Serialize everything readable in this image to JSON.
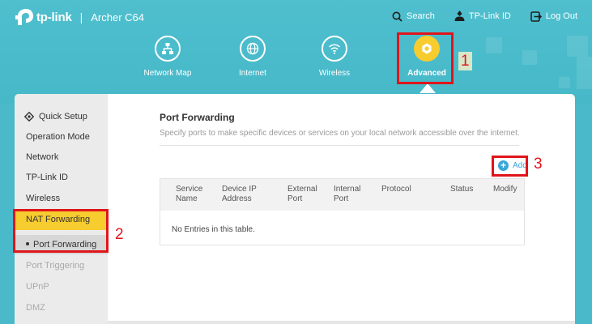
{
  "header": {
    "brand": "tp-link",
    "separator": "|",
    "model": "Archer C64",
    "links": {
      "search": "Search",
      "tplink_id": "TP-Link ID",
      "logout": "Log Out"
    }
  },
  "nav": {
    "items": [
      {
        "label": "Network Map",
        "icon": "network-map-icon"
      },
      {
        "label": "Internet",
        "icon": "globe-icon"
      },
      {
        "label": "Wireless",
        "icon": "wifi-icon"
      },
      {
        "label": "Advanced",
        "icon": "gear-icon",
        "active": true
      }
    ]
  },
  "sidebar": {
    "items": [
      {
        "label": "Quick Setup",
        "icon": "quick-setup-icon"
      },
      {
        "label": "Operation Mode"
      },
      {
        "label": "Network"
      },
      {
        "label": "TP-Link ID"
      },
      {
        "label": "Wireless"
      },
      {
        "label": "NAT Forwarding",
        "active": true
      },
      {
        "label": "Port Forwarding",
        "selected": true
      },
      {
        "label": "Port Triggering"
      },
      {
        "label": "UPnP"
      },
      {
        "label": "DMZ"
      }
    ]
  },
  "main": {
    "title": "Port Forwarding",
    "description": "Specify ports to make specific devices or services on your local network accessible over the internet.",
    "add_label": "Add",
    "table": {
      "columns": [
        [
          "Service",
          "Name"
        ],
        [
          "Device IP",
          "Address"
        ],
        [
          "External",
          "Port"
        ],
        [
          "Internal",
          "Port"
        ],
        [
          "Protocol",
          ""
        ],
        [
          "Status",
          ""
        ],
        [
          "Modify",
          ""
        ]
      ],
      "empty_text": "No Entries in this table."
    }
  },
  "annotations": {
    "labels": [
      "1",
      "2",
      "3"
    ],
    "color": "#e0151b"
  },
  "colors": {
    "header_bg": "#4fbfce",
    "accent_yellow": "#f7cc2f",
    "link_blue": "#3aa6d8"
  }
}
